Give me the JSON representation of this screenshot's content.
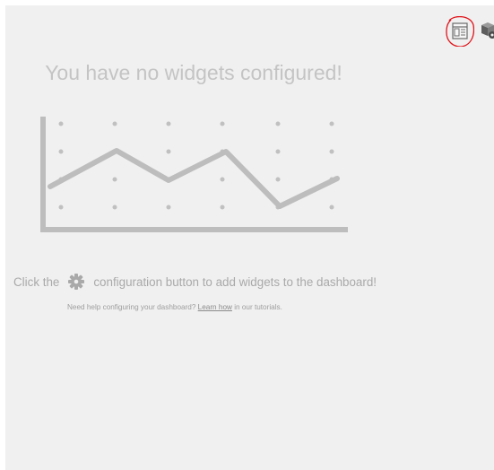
{
  "dashboard": {
    "empty_title": "You have no widgets configured!",
    "instruction_before": "Click the",
    "instruction_after": "configuration button to add widgets to the dashboard!",
    "help_before": "Need help configuring your dashboard?",
    "help_link": "Learn how",
    "help_after": "in our tutorials."
  },
  "toolbar": {
    "icons": [
      "dashboard-layout-icon",
      "cube-icon"
    ]
  },
  "colors": {
    "background": "#f0f0f0",
    "placeholder": "#c4c4c4",
    "annotation": "#e0151b"
  }
}
